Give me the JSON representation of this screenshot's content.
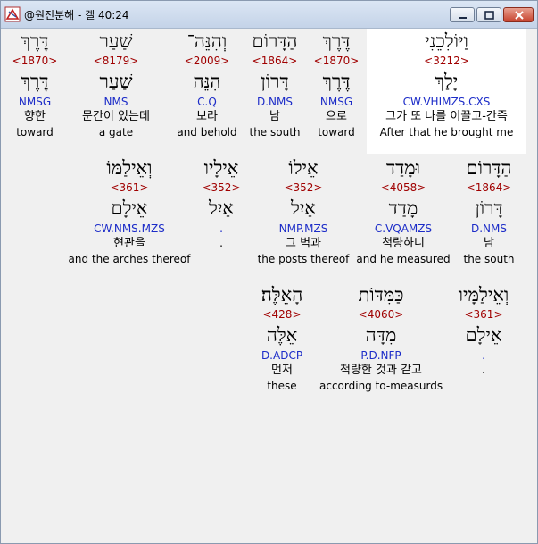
{
  "window": {
    "title": "@원전분해 - 겔 40:24",
    "controls": {
      "minimize": "minimize",
      "maximize": "maximize",
      "close": "close"
    }
  },
  "rows": [
    [
      {
        "heb": "וַיּוֹלִכֵנִי",
        "strong": "<3212>",
        "lemma": "יָלַךְ",
        "morph": "CW.VHIMZS.CXS",
        "kor": "그가 또 나를 이끌고-간즉",
        "eng": "After that he brought me"
      },
      {
        "heb": "דֶּרֶךְ",
        "strong": "<1870>",
        "lemma": "דֶּרֶךְ",
        "morph": "NMSG",
        "kor": "으로",
        "eng": "toward"
      },
      {
        "heb": "הַדָּרוֹם",
        "strong": "<1864>",
        "lemma": "דָּרוֹן",
        "morph": "D.NMS",
        "kor": "남",
        "eng": "the south"
      },
      {
        "heb": "וְהִנֵּה־",
        "strong": "<2009>",
        "lemma": "הִנֵּה",
        "morph": "C.Q",
        "kor": "보라",
        "eng": "and behold"
      },
      {
        "heb": "שַׁעַר",
        "strong": "<8179>",
        "lemma": "שַׁעַר",
        "morph": "NMS",
        "kor": "문간이 있는데",
        "eng": "a gate"
      },
      {
        "heb": "דֶּרֶךְ",
        "strong": "<1870>",
        "lemma": "דֶּרֶךְ",
        "morph": "NMSG",
        "kor": "향한",
        "eng": "toward"
      }
    ],
    [
      {
        "heb": "הַדָּרוֹם",
        "strong": "<1864>",
        "lemma": "דָּרוֹן",
        "morph": "D.NMS",
        "kor": "남",
        "eng": "the south"
      },
      {
        "heb": "וּמָדַד",
        "strong": "<4058>",
        "lemma": "מָדַד",
        "morph": "C.VQAMZS",
        "kor": "척량하니",
        "eng": "and he measured"
      },
      {
        "heb": "אֵילוֹ",
        "strong": "<352>",
        "lemma": "אַיִל",
        "morph": "NMP.MZS",
        "kor": "그 벽과",
        "eng": "the posts thereof"
      },
      {
        "heb": "אֵילָיו",
        "strong": "<352>",
        "lemma": "אַיִל",
        "morph": ".",
        "kor": "",
        "eng": "."
      },
      {
        "heb": "וְאֵילַמּוֹ",
        "strong": "<361>",
        "lemma": "אֵילָם",
        "morph": "CW.NMS.MZS",
        "kor": "현관을",
        "eng": "and the arches thereof"
      }
    ],
    [
      {
        "heb": "וְאֵילַמָּיו",
        "strong": "<361>",
        "lemma": "אֵילָם",
        "morph": ".",
        "kor": "",
        "eng": "."
      },
      {
        "heb": "כַּמִּדּוֹת",
        "strong": "<4060>",
        "lemma": "מִדָּה",
        "morph": "P.D.NFP",
        "kor": "척량한 것과 같고",
        "eng": "according to-measurds"
      },
      {
        "heb": "הָאֵלֶּה׃",
        "strong": "<428>",
        "lemma": "אֵלֶּה",
        "morph": "D.ADCP",
        "kor": "먼저",
        "eng": "these"
      }
    ]
  ]
}
